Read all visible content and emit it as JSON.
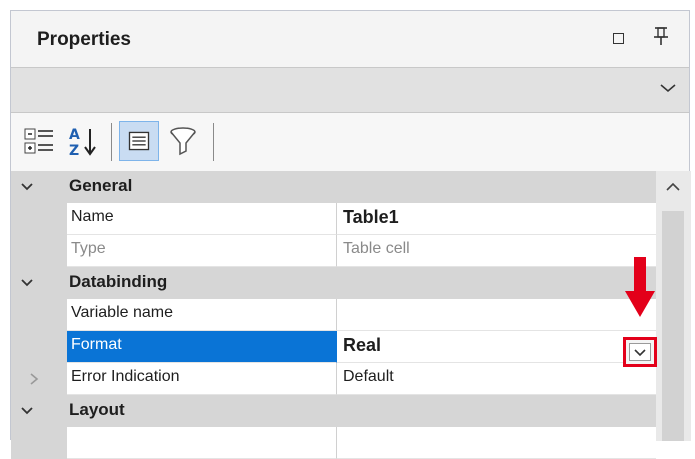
{
  "panel": {
    "title": "Properties",
    "title_buttons": [
      "restore-icon",
      "pin-icon"
    ],
    "object_selector": {
      "value": "",
      "icon": "chevron-down-icon"
    }
  },
  "toolbar": {
    "buttons": [
      {
        "name": "categorized-icon",
        "active": false
      },
      {
        "name": "sort-alphabetical-icon",
        "active": false
      },
      {
        "name": "properties-icon",
        "active": true
      },
      {
        "name": "filter-icon",
        "active": false
      }
    ]
  },
  "grid": {
    "sections": [
      {
        "label": "General",
        "expanded": true,
        "rows": [
          {
            "name": "Name",
            "value": "Table1",
            "bold": true
          },
          {
            "name": "Type",
            "value": "Table cell",
            "readonly": true
          }
        ]
      },
      {
        "label": "Databinding",
        "expanded": true,
        "rows": [
          {
            "name": "Variable name",
            "value": ""
          },
          {
            "name": "Format",
            "value": "Real",
            "bold": true,
            "selected": true
          },
          {
            "name": "Error Indication",
            "value": "Default",
            "expandable": true
          }
        ]
      },
      {
        "label": "Layout",
        "expanded": true,
        "rows": []
      }
    ]
  },
  "annotation": {
    "highlight_color": "#e3001a"
  },
  "colors": {
    "selection": "#0a74d6",
    "category_bg": "#d6d6d6"
  }
}
